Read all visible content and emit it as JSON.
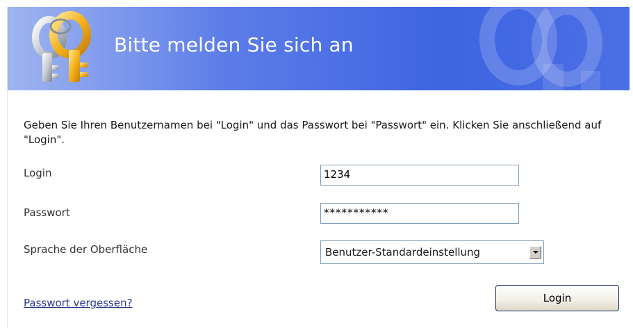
{
  "banner": {
    "title": "Bitte melden Sie sich an",
    "icon": "keys-icon",
    "colors": {
      "gradient_start": "#9fb4f0",
      "gradient_end": "#3e64e2",
      "title": "#ffffff"
    }
  },
  "instructions": "Geben Sie Ihren Benutzernamen bei \"Login\" und das Passwort bei \"Passwort\" ein. Klicken Sie anschließend auf \"Login\".",
  "form": {
    "login_label": "Login",
    "login_value": "1234",
    "password_label": "Passwort",
    "password_value": "***********",
    "language_label": "Sprache der Oberfläche",
    "language_value": "Benutzer-Standardeinstellung",
    "language_arrow_icon": "chevron-down-icon"
  },
  "forgot_password": "Passwort vergessen?",
  "login_button": "Login",
  "colors": {
    "link": "#2b3a8f",
    "button_border": "#1e2f6f",
    "field_border": "#7f9db9"
  }
}
